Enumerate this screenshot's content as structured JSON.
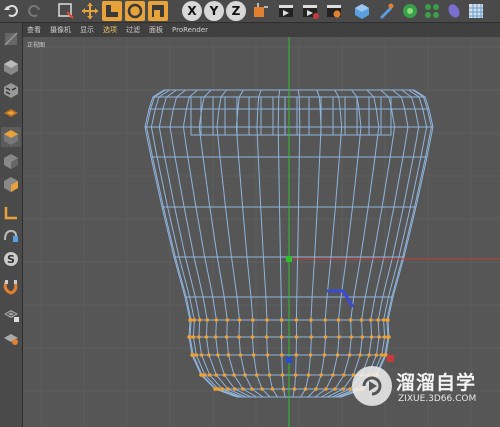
{
  "viewport": {
    "menu": [
      "查看",
      "摄像机",
      "显示",
      "选项",
      "过滤",
      "面板",
      "ProRender"
    ],
    "active_menu": "选项",
    "label": "正视图"
  },
  "toolbar": {
    "axis_x": "X",
    "axis_y": "Y",
    "axis_z": "Z",
    "icons": [
      "undo-icon",
      "redo-icon",
      "live-selection-icon",
      "move-icon",
      "scale-icon",
      "rotate-icon",
      "recent-tool-icon",
      "axis-x-icon",
      "axis-y-icon",
      "axis-z-icon",
      "coordinate-system-icon",
      "render-view-icon",
      "render-picture-viewer-icon",
      "edit-render-settings-icon",
      "cube-icon",
      "pen-icon",
      "subdivision-surface-icon",
      "cloner-icon",
      "deformer-icon",
      "floor-icon"
    ]
  },
  "left_toolbar": {
    "icons": [
      "make-editable-icon",
      "model-mode-icon",
      "texture-mode-icon",
      "points-mode-icon",
      "edges-mode-icon",
      "polygons-mode-icon",
      "object-axis-icon",
      "tweak-icon",
      "snapping-icon",
      "magnet-icon",
      "workplane-icon",
      "locked-workplane-icon"
    ]
  },
  "watermark": {
    "title": "溜溜自学",
    "subtitle": "ZIXUE.3D66.COM"
  },
  "colors": {
    "viewport_bg": "#565656",
    "wire": "#8fb4dc",
    "selected_points": "#f0a030",
    "y_axis": "#2fbf2f",
    "x_axis": "#c83a3a",
    "active_tool": "#e8a23a"
  }
}
